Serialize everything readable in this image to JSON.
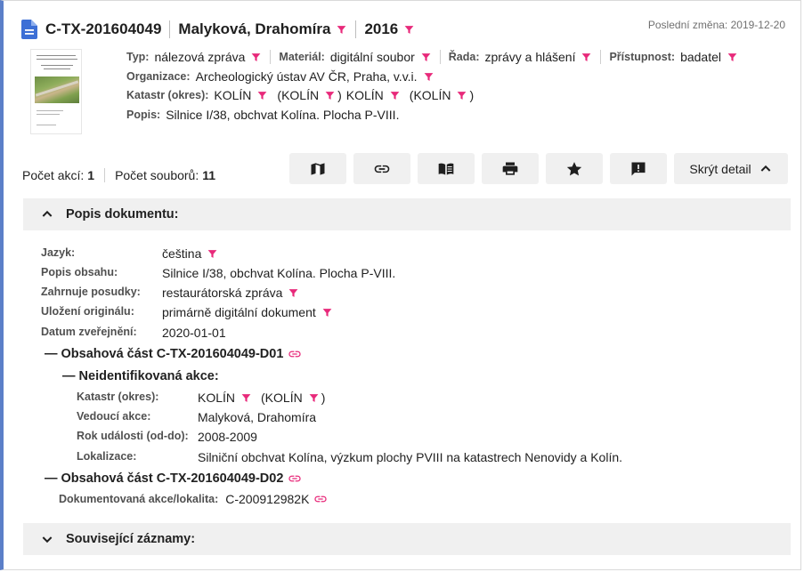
{
  "header": {
    "id": "C-TX-201604049",
    "author": "Malyková, Drahomíra",
    "year": "2016",
    "last_change_label": "Poslední změna:",
    "last_change_date": "2019-12-20"
  },
  "meta": {
    "typ_label": "Typ:",
    "typ_value": "nálezová zpráva",
    "material_label": "Materiál:",
    "material_value": "digitální soubor",
    "rada_label": "Řada:",
    "rada_value": "zprávy a hlášení",
    "pristupnost_label": "Přístupnost:",
    "pristupnost_value": "badatel",
    "organizace_label": "Organizace:",
    "organizace_value": "Archeologický ústav AV ČR, Praha, v.v.i.",
    "katastr_label": "Katastr (okres):",
    "katastr_value1": "KOLÍN",
    "katastr_value2": "(KOLÍN",
    "katastr_paren_close": ")",
    "katastr_value3": "KOLÍN",
    "katastr_value4": "(KOLÍN",
    "popis_label": "Popis:",
    "popis_value": "Silnice I/38, obchvat Kolína. Plocha P-VIII."
  },
  "counts": {
    "akci_label": "Počet akcí:",
    "akci_value": "1",
    "souboru_label": "Počet souborů:",
    "souboru_value": "11"
  },
  "toolbar": {
    "buttons": [
      "map-icon",
      "link-icon",
      "book-icon",
      "print-icon",
      "star-icon",
      "feedback-icon"
    ],
    "hide_detail_label": "Skrýt detail"
  },
  "popis_section": {
    "title": "Popis dokumentu:",
    "rows": [
      {
        "label": "Jazyk:",
        "value": "čeština"
      },
      {
        "label": "Popis obsahu:",
        "value": "Silnice I/38, obchvat Kolína. Plocha P-VIII."
      },
      {
        "label": "Zahrnuje posudky:",
        "value": "restaurátorská zpráva"
      },
      {
        "label": "Uložení originálu:",
        "value": "primárně digitální dokument"
      },
      {
        "label": "Datum zveřejnění:",
        "value": "2020-01-01"
      }
    ],
    "part1": {
      "title": "— Obsahová část C-TX-201604049-D01",
      "akce_title": "— Neidentifikovaná akce:",
      "rows": [
        {
          "label": "Katastr (okres):",
          "value": "KOLÍN",
          "value2": "(KOLÍN",
          "close": ")"
        },
        {
          "label": "Vedoucí akce:",
          "value": "Malyková, Drahomíra"
        },
        {
          "label": "Rok události (od-do):",
          "value": "2008-2009"
        },
        {
          "label": "Lokalizace:",
          "value": "Silniční obchvat Kolína, výzkum plochy PVIII na katastrech Nenovidy a Kolín."
        }
      ]
    },
    "part2": {
      "title": "— Obsahová část C-TX-201604049-D02",
      "row_label": "Dokumentovaná akce/lokalita:",
      "row_value": "C-200912982K"
    }
  },
  "related_section": {
    "title": "Související záznamy:"
  },
  "colors": {
    "accent_blue": "#5b7fc8",
    "filter_pink": "#e8297a",
    "doc_icon_blue": "#3d6fd6"
  }
}
